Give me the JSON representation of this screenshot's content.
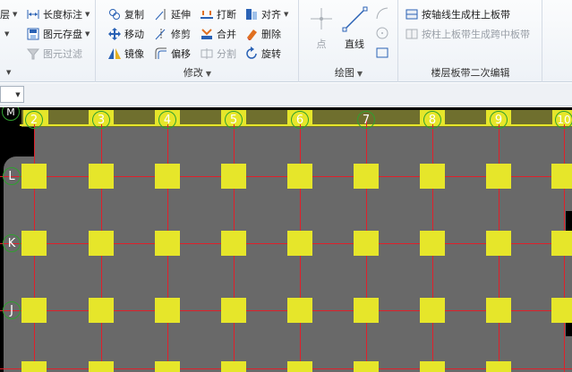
{
  "ribbon": {
    "left_partial": {
      "layer_label": "层",
      "length_dim_label": "长度标注",
      "element_save_label": "图元存盘",
      "element_filter_label": "图元过滤"
    },
    "modify": {
      "group_label": "修改",
      "copy": "复制",
      "extend": "延伸",
      "break": "打断",
      "align": "对齐",
      "move": "移动",
      "trim": "修剪",
      "merge": "合并",
      "delete": "删除",
      "mirror": "镜像",
      "offset": "偏移",
      "split": "分割",
      "rotate": "旋转"
    },
    "draw": {
      "group_label": "绘图",
      "point": "点",
      "line": "直线"
    },
    "floor_slab": {
      "group_label": "楼层板带二次编辑",
      "gen_column_strip": "按轴线生成柱上板带",
      "gen_span_strip": "按柱上板带生成跨中板带"
    }
  },
  "quickbar": {
    "combo_value": ""
  },
  "canvas": {
    "x_axes": [
      "2",
      "3",
      "4",
      "5",
      "6",
      "7",
      "8",
      "9",
      "10"
    ],
    "y_axes": [
      "M",
      "L",
      "K",
      "J"
    ],
    "colors": {
      "slab": "#696969",
      "column": "#e6e62a",
      "axis": "#e0202a",
      "bubble": "#2fa02f",
      "background": "#000000"
    }
  }
}
